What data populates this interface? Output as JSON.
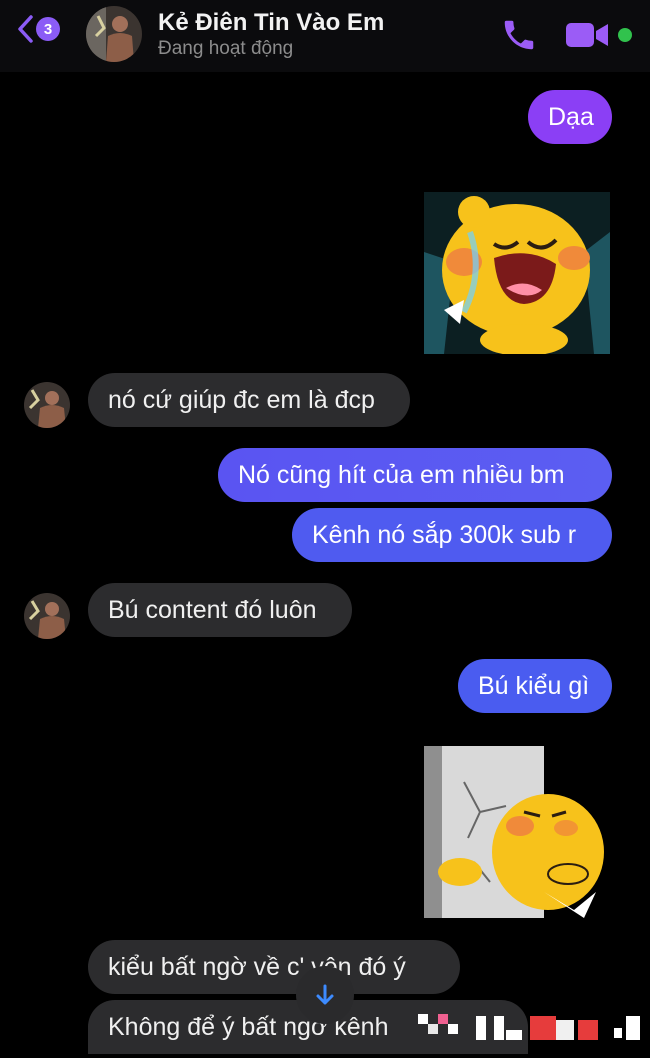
{
  "header": {
    "back_badge": "3",
    "contact_name": "Kẻ Điên Tin Vào Em",
    "status": "Đang hoạt động",
    "icons": {
      "back": "chevron-left-icon",
      "call": "phone-icon",
      "video": "video-camera-icon"
    }
  },
  "messages": [
    {
      "from": "me",
      "type": "text",
      "text": "Dạa"
    },
    {
      "from": "me",
      "type": "sticker",
      "sticker": "crying-yellow-chick-sticker"
    },
    {
      "from": "them",
      "type": "text",
      "text": "nó cứ giúp đc em là đcp"
    },
    {
      "from": "me",
      "type": "text",
      "text": "Nó cũng hít của em nhiều bm"
    },
    {
      "from": "me",
      "type": "text",
      "text": "Kênh nó sắp 300k sub r"
    },
    {
      "from": "them",
      "type": "text",
      "text": "Bú content đó luôn"
    },
    {
      "from": "me",
      "type": "text",
      "text": "Bú kiểu gì"
    },
    {
      "from": "me",
      "type": "sticker",
      "sticker": "yellow-chick-breaking-wall-sticker"
    },
    {
      "from": "them",
      "type": "text",
      "text": "kiểu bất ngờ về c' vện đó ý"
    },
    {
      "from": "them",
      "type": "text",
      "text": "Không để ý bất ngơ kênh"
    }
  ],
  "colors": {
    "background": "#000000",
    "outgoing_bubble_top": "#8a3ff5",
    "outgoing_bubble_bottom": "#4a5cf0",
    "incoming_bubble": "#2c2c2e",
    "accent": "#8b5cf6",
    "online": "#31c24d"
  }
}
